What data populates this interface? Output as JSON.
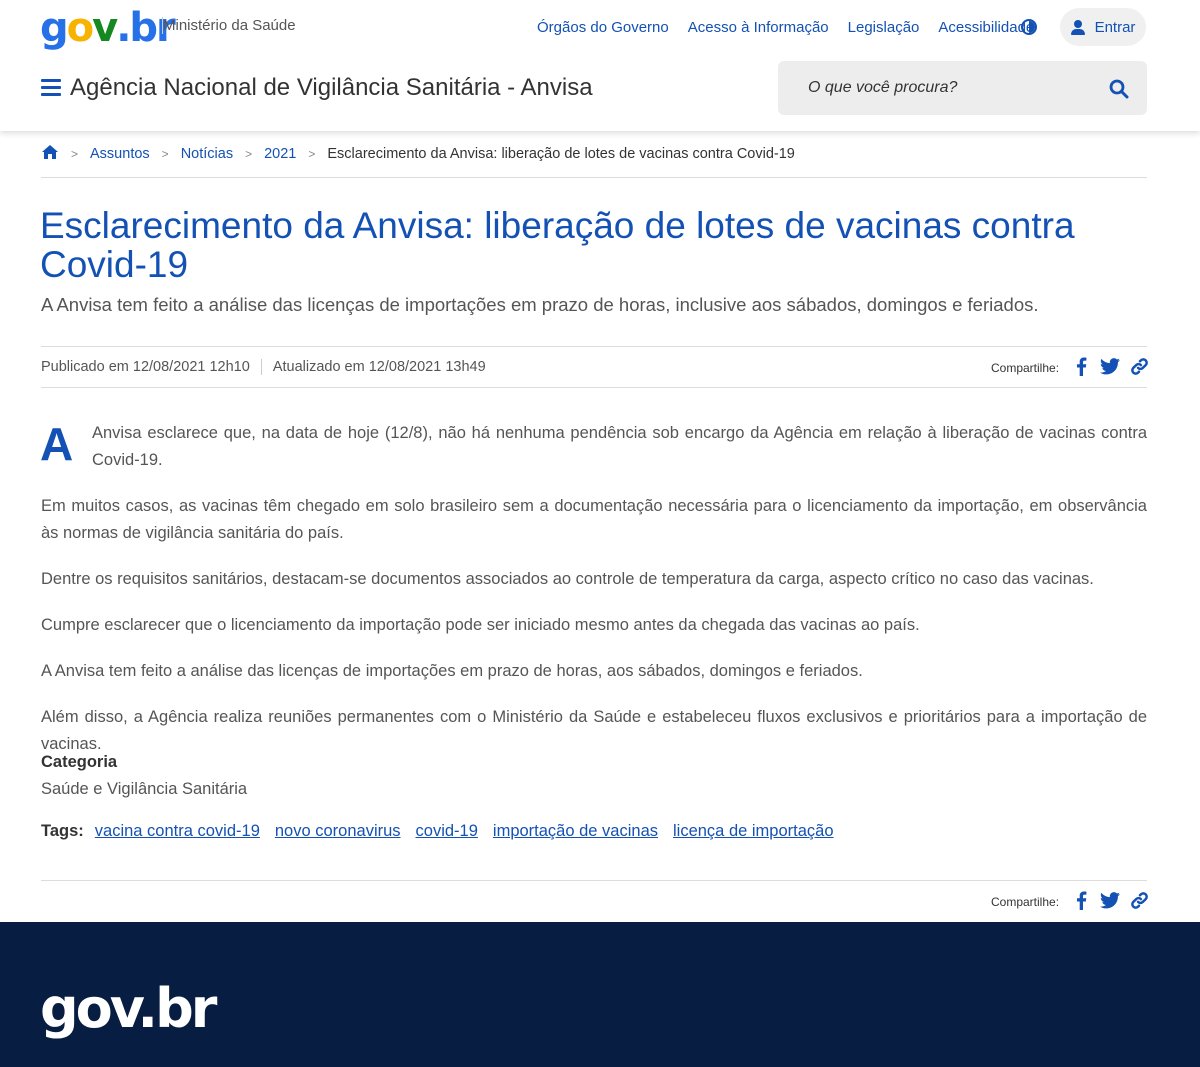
{
  "header": {
    "logo": {
      "g": "g",
      "o": "o",
      "v": "v",
      "dot": ".",
      "b": "b",
      "r": "r"
    },
    "ministry": "Ministério da Saúde",
    "top_links": [
      "Órgãos do Governo",
      "Acesso à Informação",
      "Legislação",
      "Acessibilidade"
    ],
    "login_label": "Entrar",
    "site_title": "Agência Nacional de Vigilância Sanitária - Anvisa",
    "search_placeholder": "O que você procura?"
  },
  "breadcrumb": {
    "items": [
      "Assuntos",
      "Notícias",
      "2021"
    ],
    "current": "Esclarecimento da Anvisa: liberação de lotes de vacinas contra Covid-19"
  },
  "article": {
    "title": "Esclarecimento da Anvisa: liberação de lotes de vacinas contra Covid-19",
    "subtitle": "A Anvisa tem feito a análise das licenças de importações em prazo de horas, inclusive aos sábados, domingos e feriados.",
    "published": "Publicado em 12/08/2021 12h10",
    "updated": "Atualizado em 12/08/2021 13h49",
    "share_label": "Compartilhe:",
    "dropcap": "A",
    "paragraphs": [
      "Anvisa esclarece que, na data de hoje (12/8), não há nenhuma pendência sob encargo da Agência em relação à liberação de vacinas contra Covid-19.",
      "Em muitos casos, as vacinas têm chegado em solo brasileiro sem a documentação necessária para o licenciamento da importação, em observância às normas de vigilância sanitária do país.",
      "Dentre os requisitos sanitários, destacam-se documentos associados ao controle de temperatura da carga, aspecto crítico no caso das vacinas.",
      "Cumpre esclarecer que o licenciamento da importação pode ser iniciado mesmo antes da chegada das vacinas ao país.",
      "A Anvisa tem feito a análise das licenças de importações em prazo de horas, aos sábados, domingos e feriados.",
      "Além disso, a Agência realiza reuniões permanentes com o Ministério da Saúde e estabeleceu fluxos exclusivos e prioritários para a importação de vacinas."
    ],
    "category_label": "Categoria",
    "category_value": "Saúde e Vigilância Sanitária",
    "tags_label": "Tags:",
    "tags": [
      "vacina contra covid-19",
      "novo coronavirus",
      "covid-19",
      "importação de vacinas",
      "licença de importação"
    ]
  },
  "footer": {
    "logo": "gov.br"
  },
  "colors": {
    "primary_blue": "#1351b4",
    "footer_navy": "#071d41",
    "logo_blue": "#2670e8",
    "logo_yellow": "#f8b200",
    "logo_green": "#168821"
  },
  "icons": [
    "home-icon",
    "menu-icon",
    "search-icon",
    "contrast-icon",
    "user-icon",
    "facebook-icon",
    "twitter-icon",
    "link-icon"
  ]
}
